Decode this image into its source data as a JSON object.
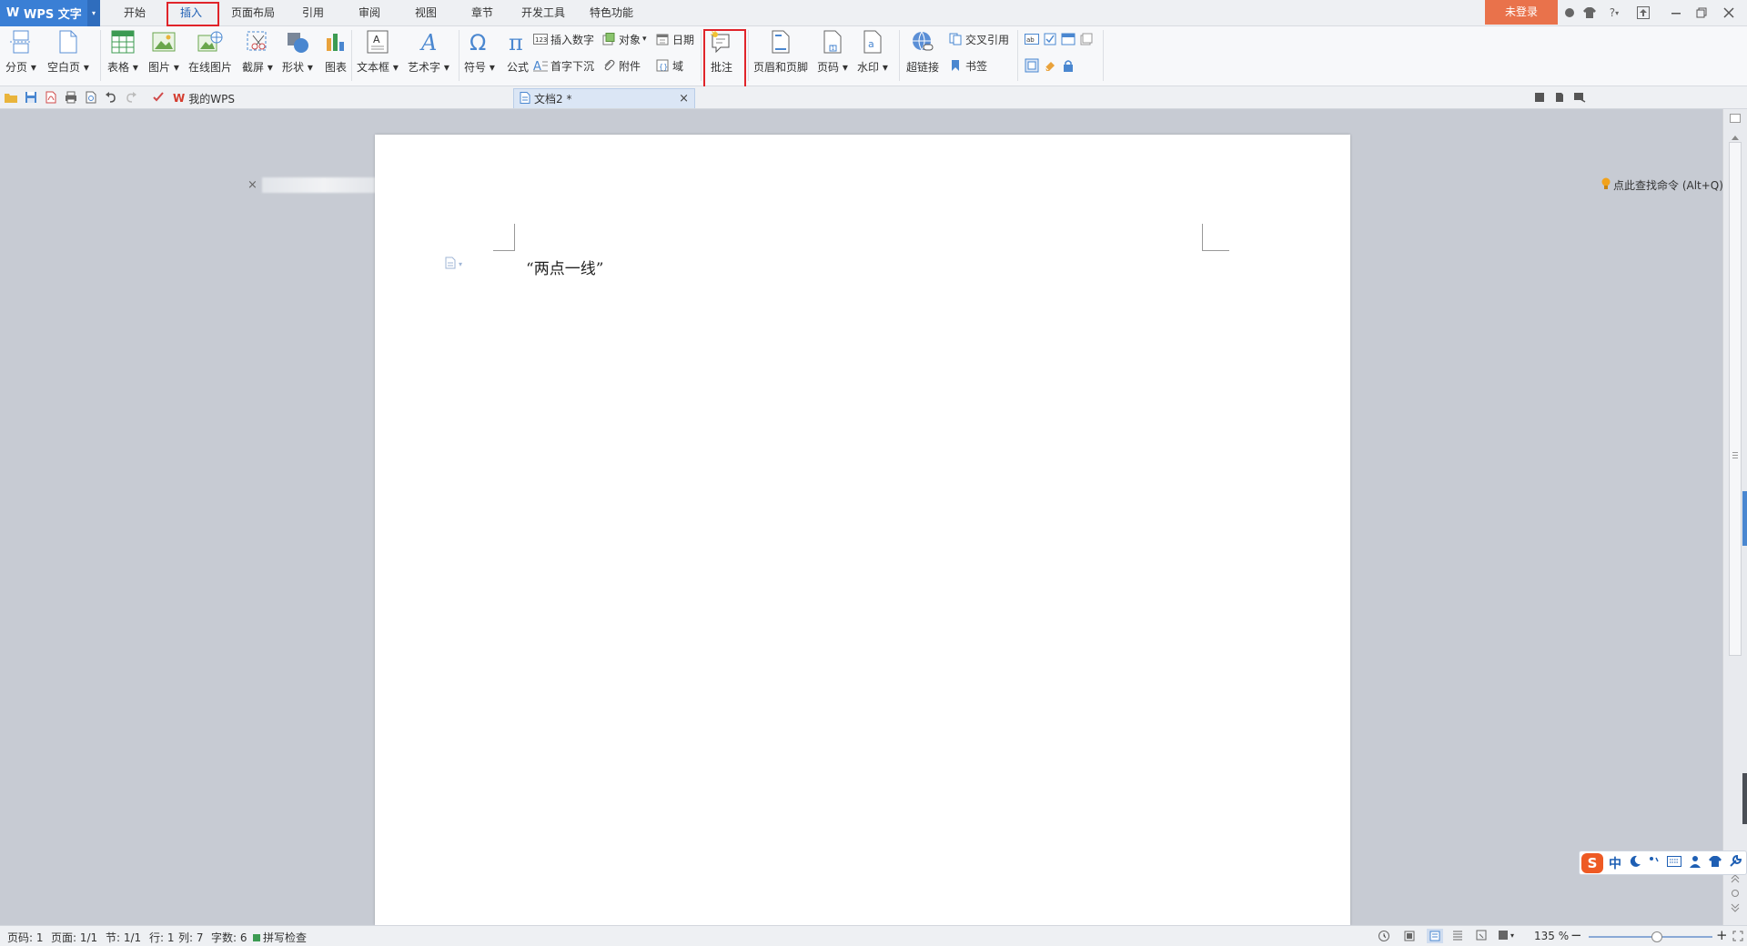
{
  "app": {
    "name": "WPS 文字",
    "logo_letter": "W"
  },
  "menu_tabs": [
    "开始",
    "插入",
    "页面布局",
    "引用",
    "审阅",
    "视图",
    "章节",
    "开发工具",
    "特色功能"
  ],
  "login_label": "未登录",
  "help_label": "?",
  "ribbon": {
    "page_break": "分页",
    "blank_page": "空白页",
    "table": "表格",
    "picture": "图片",
    "online_picture": "在线图片",
    "screenshot": "截屏",
    "shapes": "形状",
    "chart": "图表",
    "textbox": "文本框",
    "wordart": "艺术字",
    "symbol": "符号",
    "equation": "公式",
    "insert_number": "插入数字",
    "object": "对象",
    "date": "日期",
    "drop_cap": "首字下沉",
    "attachment": "附件",
    "field": "域",
    "comment": "批注",
    "header_footer": "页眉和页脚",
    "page_number": "页码",
    "watermark": "水印",
    "hyperlink": "超链接",
    "cross_reference": "交叉引用",
    "bookmark": "书签",
    "dropdown_marker": "▾"
  },
  "tabs_row": {
    "my_wps": "我的WPS",
    "doc_tab": "文档2 *",
    "close_glyph": "×",
    "new_tab_glyph": "+",
    "search_hint": "点此查找命令 (Alt+Q)"
  },
  "document": {
    "text": "“两点一线”"
  },
  "statusbar": {
    "page_num": "页码: 1",
    "pages": "页面: 1/1",
    "section": "节: 1/1",
    "row": "行: 1",
    "col": "列: 7",
    "word_count": "字数: 6",
    "spell_check": "拼写检查",
    "zoom": "135 %",
    "zoom_minus": "−",
    "zoom_plus": "+",
    "zoom_level": 0.55
  },
  "ime": {
    "logo": "S",
    "mode": "中"
  },
  "colors": {
    "accent": "#3a7fd5",
    "highlight": "#e0242a",
    "login": "#e9724b"
  }
}
